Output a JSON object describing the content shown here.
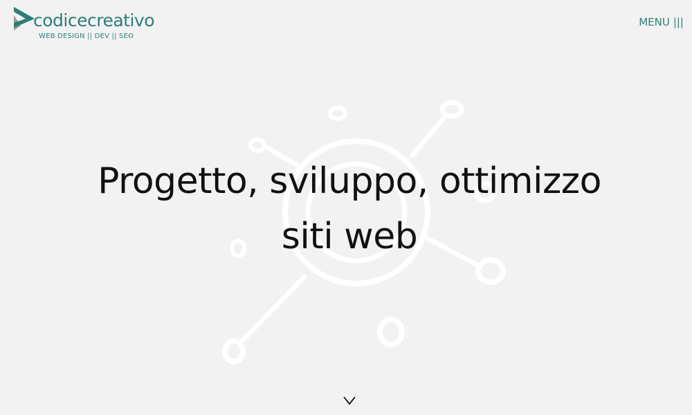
{
  "header": {
    "logo": {
      "name": "codicecreativo",
      "tagline": "WEB DESIGN || DEV || SEO",
      "icon": "play-triangle-logo-icon"
    },
    "menu": {
      "label": "MENU",
      "icon_glyph": "|||",
      "icon": "hamburger-icon"
    }
  },
  "hero": {
    "line1": "Progetto, sviluppo, ottimizzo",
    "line2": "siti web",
    "background_icon": "network-nodes-icon",
    "scroll_icon": "chevron-down-icon"
  },
  "colors": {
    "background": "#f2f2f2",
    "brand_teal": "#2e7d77",
    "brand_gray": "#9a9a9a",
    "title_text": "#111111",
    "graphic_white": "#ffffff"
  }
}
